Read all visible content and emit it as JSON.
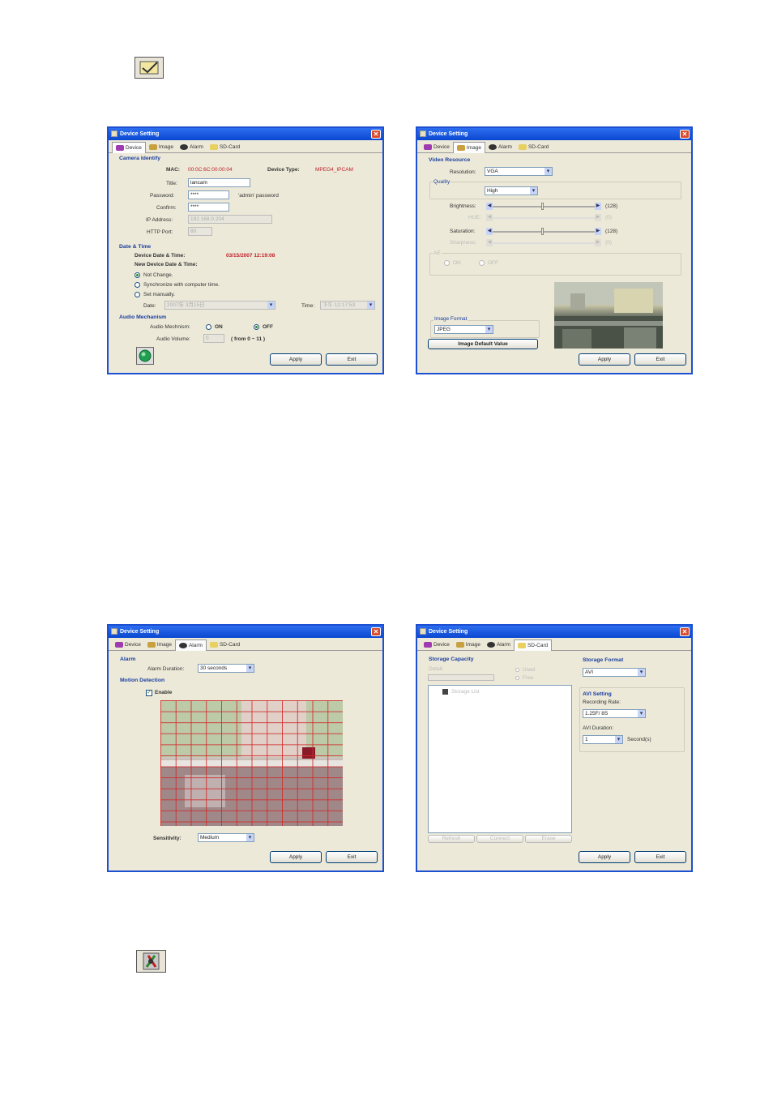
{
  "window_title": "Device Setting",
  "tabs": [
    "Device",
    "Image",
    "Alarm",
    "SD-Card"
  ],
  "buttons": {
    "apply": "Apply",
    "exit": "Exit"
  },
  "device": {
    "section_camera": "Camera Identify",
    "mac_label": "MAC:",
    "mac_value": "00:0C:6C:00:00:04",
    "device_type_label": "Device Type:",
    "device_type_value": "MPEG4_IPCAM",
    "title_label": "Title:",
    "title_value": "lancam",
    "password_label": "Password:",
    "password_value": "****",
    "password_hint": "'admin' password",
    "confirm_label": "Confirm:",
    "confirm_value": "****",
    "ip_label": "IP Address:",
    "ip_value": "192.168.0.204",
    "http_label": "HTTP Port:",
    "http_value": "80",
    "section_datetime": "Date & Time",
    "device_dt_label": "Device Date & Time:",
    "device_dt_value": "03/15/2007 12:19:08",
    "new_dt_label": "New Device Date & Time:",
    "opt_not_change": "Not Change.",
    "opt_sync": "Synchronize with computer time.",
    "opt_manual": "Set manually.",
    "date_label": "Date:",
    "date_value": "2007年 3月15日",
    "time_label": "Time:",
    "time_value": "下午 12:17:53",
    "section_audio": "Audio Mechanism",
    "audio_mech_label": "Audio Mechnism:",
    "on_label": "ON",
    "off_label": "OFF",
    "audio_vol_label": "Audio Volume:",
    "audio_vol_value": "0",
    "audio_range": "( from 0 ~ 11 )"
  },
  "image": {
    "section_video": "Video Resource",
    "resolution_label": "Resolution:",
    "resolution_value": "VGA",
    "quality_label": "Quality",
    "quality_value": "High",
    "brightness_label": "Brightness:",
    "brightness_value": "(128)",
    "hue_label": "HUE:",
    "hue_value": "(0)",
    "saturation_label": "Saturation:",
    "saturation_value": "(128)",
    "sharpness_label": "Sharpness:",
    "sharpness_value": "(0)",
    "ae_label": "AE",
    "ae_on": "ON",
    "ae_off": "OFF",
    "format_label": "Image Format",
    "format_value": "JPEG",
    "default_button": "Image Default Value"
  },
  "alarm": {
    "section_alarm": "Alarm",
    "duration_label": "Alarm Duration:",
    "duration_value": "30 seconds",
    "section_motion": "Motion Detection",
    "enable_label": "Enable",
    "sensitivity_label": "Sensitivity:",
    "sensitivity_value": "Medium"
  },
  "sdcard": {
    "section_storage": "Storage Capacity",
    "detail_label": "Detail:",
    "used_label": "Used",
    "free_label": "Free",
    "tree_item": "Storage List",
    "btn_refresh": "Refresh",
    "btn_connect": "Connect",
    "btn_erase": "Erase",
    "section_format": "Storage Format",
    "format_value": "AVI",
    "section_avi": "AVI Setting",
    "rate_label": "Recording Rate:",
    "rate_value": "1.25F/ 8S",
    "duration_label": "AVI Duration:",
    "duration_value": "1",
    "duration_unit": "Second(s)"
  }
}
